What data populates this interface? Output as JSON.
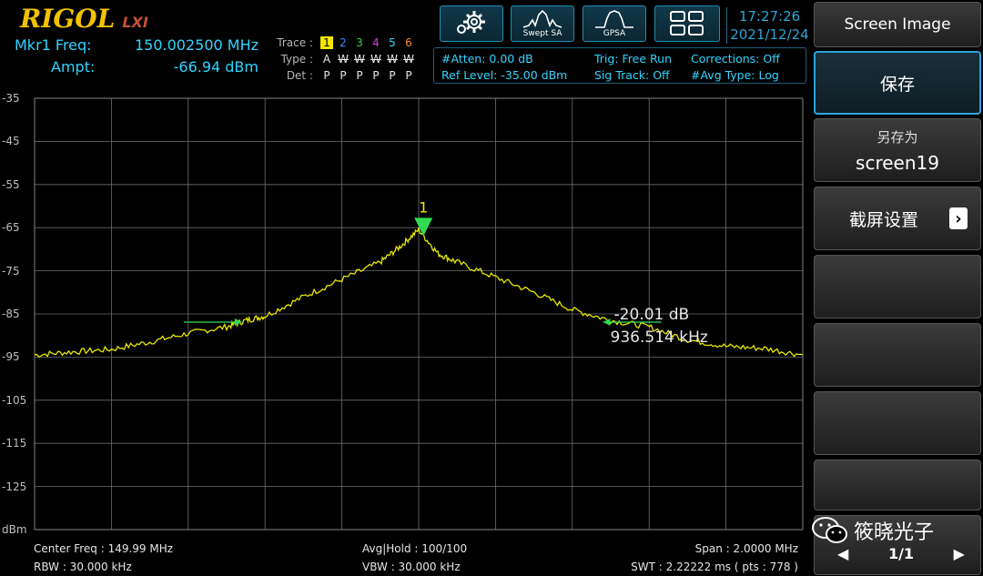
{
  "header": {
    "brand": "RIGOL",
    "lxi": "LXI",
    "buttons": [
      {
        "name": "settings",
        "caption": ""
      },
      {
        "name": "swept-sa",
        "caption": "Swept SA"
      },
      {
        "name": "gpsa",
        "caption": "GPSA"
      },
      {
        "name": "layout",
        "caption": ""
      }
    ],
    "time": "17:27:26",
    "date": "2021/12/24"
  },
  "marker": {
    "freq_label": "Mkr1 Freq:",
    "freq_value": "150.002500 MHz",
    "ampt_label": "Ampt:",
    "ampt_value": "-66.94 dBm"
  },
  "trace": {
    "trace_label": "Trace :",
    "type_label": "Type :",
    "det_label": "Det :",
    "numbers": [
      "1",
      "2",
      "3",
      "4",
      "5",
      "6"
    ],
    "number_colors": [
      "#f2e600",
      "#2f8cff",
      "#39d23c",
      "#d040d0",
      "#31d4ff",
      "#ff8a2a"
    ],
    "types": [
      "A",
      "W",
      "W",
      "W",
      "W",
      "W"
    ],
    "dets": [
      "P",
      "P",
      "P",
      "P",
      "P",
      "P"
    ]
  },
  "status": {
    "atten": "#Atten: 0.00 dB",
    "ref_level": "Ref Level: -35.00 dBm",
    "trig": "Trig: Free Run",
    "sig_track": "Sig Track: Off",
    "corrections": "Corrections: Off",
    "avg_type": "#Avg Type: Log"
  },
  "chart_data": {
    "type": "line",
    "y_tick_labels": [
      "-35",
      "-45",
      "-55",
      "-65",
      "-75",
      "-85",
      "-95",
      "-105",
      "-115",
      "-125",
      "dBm"
    ],
    "ylim": [
      -135,
      -35
    ],
    "x_range_mhz": [
      148.99,
      150.99
    ],
    "series": [
      {
        "x": [
          148.99,
          149.09,
          149.19,
          149.29,
          149.39,
          149.49,
          149.54,
          149.59,
          149.69,
          149.79,
          149.89,
          149.94,
          149.99,
          150.04,
          150.09,
          150.19,
          150.29,
          150.39,
          150.49,
          150.59,
          150.69,
          150.79,
          150.89,
          150.99
        ],
        "y": [
          -94.5,
          -93.8,
          -93.2,
          -91.5,
          -89.5,
          -88,
          -86.5,
          -85.5,
          -81,
          -77,
          -73,
          -69.5,
          -65.5,
          -71,
          -73,
          -76.5,
          -80,
          -84,
          -86.5,
          -88,
          -91,
          -92.5,
          -93,
          -94.5
        ]
      }
    ],
    "marker": {
      "label": "1",
      "x": 150.0025,
      "y": -66.94
    },
    "ndb_markers": {
      "left_x": 149.53,
      "right_x": 150.47,
      "y": -86.9
    },
    "annotation_db": "-20.01 dB",
    "annotation_bw": "936.514 kHz"
  },
  "footer": {
    "center_freq": "Center Freq : 149.99 MHz",
    "rbw": "RBW : 30.000 kHz",
    "avg_hold": "Avg|Hold : 100/100",
    "vbw": "VBW : 30.000 kHz",
    "span": "Span : 2.0000 MHz",
    "swt": "SWT : 2.22222 ms ( pts : 778 )"
  },
  "softkeys": {
    "title": "Screen Image",
    "save": "保存",
    "save_as_label": "另存为",
    "save_as_value": "screen19",
    "capture_settings": "截屏设置",
    "page": "1/1"
  },
  "watermark": "筱晓光子",
  "colors": {
    "trace": "#e8e800",
    "marker": "#2fdc52",
    "grid": "#6e6e6e"
  }
}
